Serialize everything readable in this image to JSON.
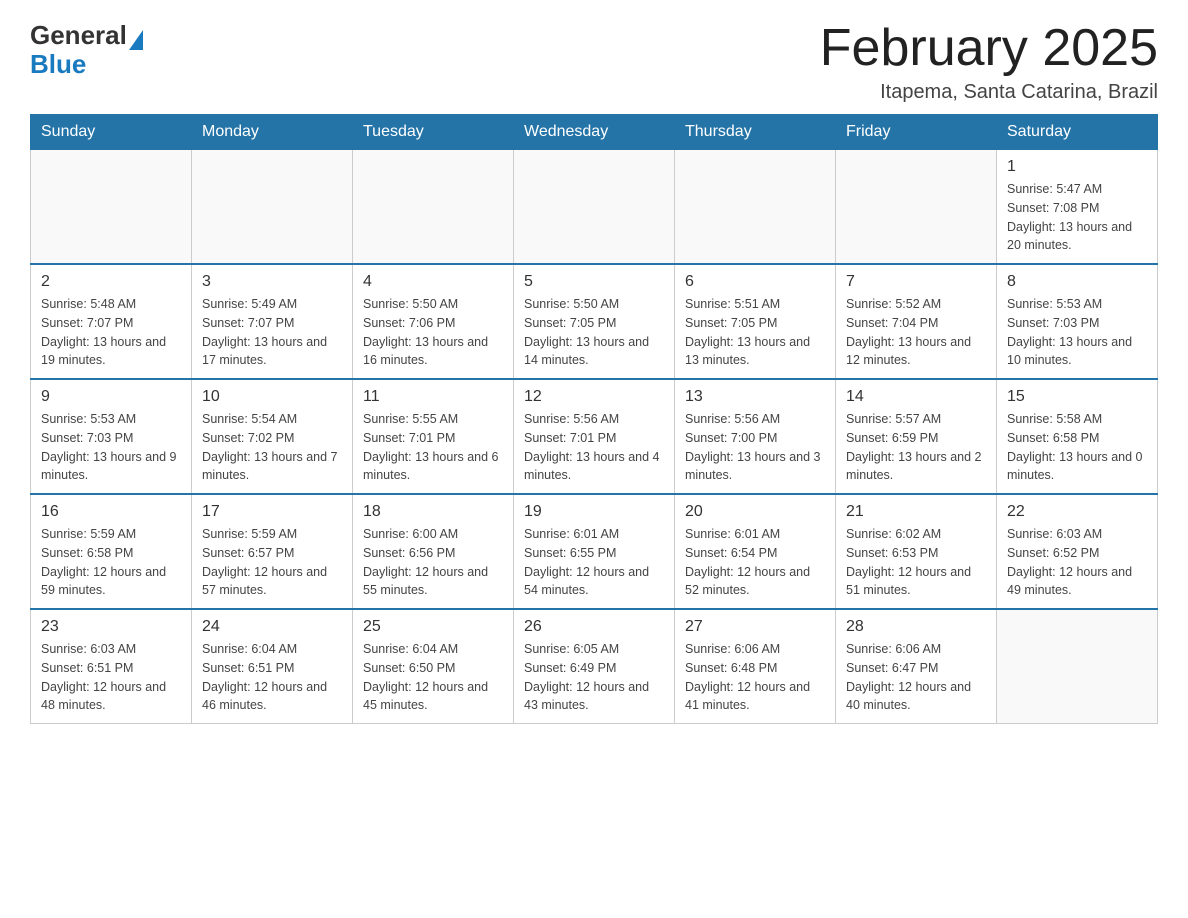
{
  "logo": {
    "general": "General",
    "blue": "Blue"
  },
  "header": {
    "month_title": "February 2025",
    "location": "Itapema, Santa Catarina, Brazil"
  },
  "weekdays": [
    "Sunday",
    "Monday",
    "Tuesday",
    "Wednesday",
    "Thursday",
    "Friday",
    "Saturday"
  ],
  "weeks": [
    [
      {
        "day": "",
        "info": ""
      },
      {
        "day": "",
        "info": ""
      },
      {
        "day": "",
        "info": ""
      },
      {
        "day": "",
        "info": ""
      },
      {
        "day": "",
        "info": ""
      },
      {
        "day": "",
        "info": ""
      },
      {
        "day": "1",
        "info": "Sunrise: 5:47 AM\nSunset: 7:08 PM\nDaylight: 13 hours and 20 minutes."
      }
    ],
    [
      {
        "day": "2",
        "info": "Sunrise: 5:48 AM\nSunset: 7:07 PM\nDaylight: 13 hours and 19 minutes."
      },
      {
        "day": "3",
        "info": "Sunrise: 5:49 AM\nSunset: 7:07 PM\nDaylight: 13 hours and 17 minutes."
      },
      {
        "day": "4",
        "info": "Sunrise: 5:50 AM\nSunset: 7:06 PM\nDaylight: 13 hours and 16 minutes."
      },
      {
        "day": "5",
        "info": "Sunrise: 5:50 AM\nSunset: 7:05 PM\nDaylight: 13 hours and 14 minutes."
      },
      {
        "day": "6",
        "info": "Sunrise: 5:51 AM\nSunset: 7:05 PM\nDaylight: 13 hours and 13 minutes."
      },
      {
        "day": "7",
        "info": "Sunrise: 5:52 AM\nSunset: 7:04 PM\nDaylight: 13 hours and 12 minutes."
      },
      {
        "day": "8",
        "info": "Sunrise: 5:53 AM\nSunset: 7:03 PM\nDaylight: 13 hours and 10 minutes."
      }
    ],
    [
      {
        "day": "9",
        "info": "Sunrise: 5:53 AM\nSunset: 7:03 PM\nDaylight: 13 hours and 9 minutes."
      },
      {
        "day": "10",
        "info": "Sunrise: 5:54 AM\nSunset: 7:02 PM\nDaylight: 13 hours and 7 minutes."
      },
      {
        "day": "11",
        "info": "Sunrise: 5:55 AM\nSunset: 7:01 PM\nDaylight: 13 hours and 6 minutes."
      },
      {
        "day": "12",
        "info": "Sunrise: 5:56 AM\nSunset: 7:01 PM\nDaylight: 13 hours and 4 minutes."
      },
      {
        "day": "13",
        "info": "Sunrise: 5:56 AM\nSunset: 7:00 PM\nDaylight: 13 hours and 3 minutes."
      },
      {
        "day": "14",
        "info": "Sunrise: 5:57 AM\nSunset: 6:59 PM\nDaylight: 13 hours and 2 minutes."
      },
      {
        "day": "15",
        "info": "Sunrise: 5:58 AM\nSunset: 6:58 PM\nDaylight: 13 hours and 0 minutes."
      }
    ],
    [
      {
        "day": "16",
        "info": "Sunrise: 5:59 AM\nSunset: 6:58 PM\nDaylight: 12 hours and 59 minutes."
      },
      {
        "day": "17",
        "info": "Sunrise: 5:59 AM\nSunset: 6:57 PM\nDaylight: 12 hours and 57 minutes."
      },
      {
        "day": "18",
        "info": "Sunrise: 6:00 AM\nSunset: 6:56 PM\nDaylight: 12 hours and 55 minutes."
      },
      {
        "day": "19",
        "info": "Sunrise: 6:01 AM\nSunset: 6:55 PM\nDaylight: 12 hours and 54 minutes."
      },
      {
        "day": "20",
        "info": "Sunrise: 6:01 AM\nSunset: 6:54 PM\nDaylight: 12 hours and 52 minutes."
      },
      {
        "day": "21",
        "info": "Sunrise: 6:02 AM\nSunset: 6:53 PM\nDaylight: 12 hours and 51 minutes."
      },
      {
        "day": "22",
        "info": "Sunrise: 6:03 AM\nSunset: 6:52 PM\nDaylight: 12 hours and 49 minutes."
      }
    ],
    [
      {
        "day": "23",
        "info": "Sunrise: 6:03 AM\nSunset: 6:51 PM\nDaylight: 12 hours and 48 minutes."
      },
      {
        "day": "24",
        "info": "Sunrise: 6:04 AM\nSunset: 6:51 PM\nDaylight: 12 hours and 46 minutes."
      },
      {
        "day": "25",
        "info": "Sunrise: 6:04 AM\nSunset: 6:50 PM\nDaylight: 12 hours and 45 minutes."
      },
      {
        "day": "26",
        "info": "Sunrise: 6:05 AM\nSunset: 6:49 PM\nDaylight: 12 hours and 43 minutes."
      },
      {
        "day": "27",
        "info": "Sunrise: 6:06 AM\nSunset: 6:48 PM\nDaylight: 12 hours and 41 minutes."
      },
      {
        "day": "28",
        "info": "Sunrise: 6:06 AM\nSunset: 6:47 PM\nDaylight: 12 hours and 40 minutes."
      },
      {
        "day": "",
        "info": ""
      }
    ]
  ]
}
